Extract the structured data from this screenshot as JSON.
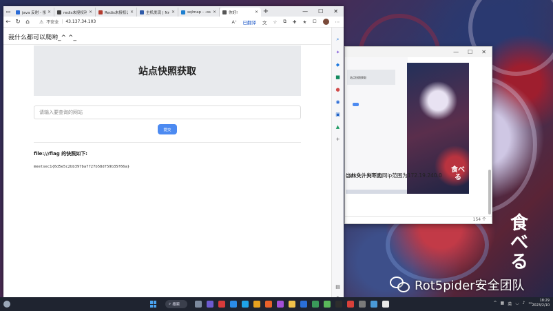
{
  "browser": {
    "tabs": [
      {
        "label": "java 反射 - 搜索",
        "color": "#2b6bd6"
      },
      {
        "label": "redis未授权利用",
        "color": "#444444"
      },
      {
        "label": "Redis未授权访问",
        "color": "#b33b2e"
      },
      {
        "label": "主机发现 | Nmap",
        "color": "#2f5aa8"
      },
      {
        "label": "sqlmap - -os-sh",
        "color": "#1d7fd0"
      },
      {
        "label": "你好!",
        "color": "#555555",
        "active": true
      }
    ],
    "new_tab": "+",
    "window_controls": {
      "minimize": "—",
      "maximize": "☐",
      "close": "✕"
    },
    "security_label": "不安全",
    "url": "43.137.34.103",
    "translated_label": "已翻译"
  },
  "page": {
    "site_header": "我什么都可以爬哟_^ ^_",
    "hero_title": "站点快照获取",
    "input_placeholder": "请输入要查询的网站",
    "submit_label": "提交",
    "result_title": "file:///flag 的快照如下:",
    "result_body": "meetsec1{6d5e5c2bb397ba7727b58df59b35f66a}"
  },
  "bg_window": {
    "controls": {
      "minimize": "—",
      "maximize": "☐",
      "close": "✕"
    },
    "shot_box_text": "站点快照获取",
    "text_line_1": "osts头，判断内网ip范围为172.19.240.0",
    "text_line_2": "当前文件夹下面",
    "status": "154 个",
    "wallpaper_text": "食べる"
  },
  "taskbar": {
    "search_label": "搜索",
    "tray_lang": "英",
    "time": "18:29",
    "date": "2023/2/10"
  },
  "wallpaper_text": "食べる",
  "watermark": "Rot5pider安全团队"
}
